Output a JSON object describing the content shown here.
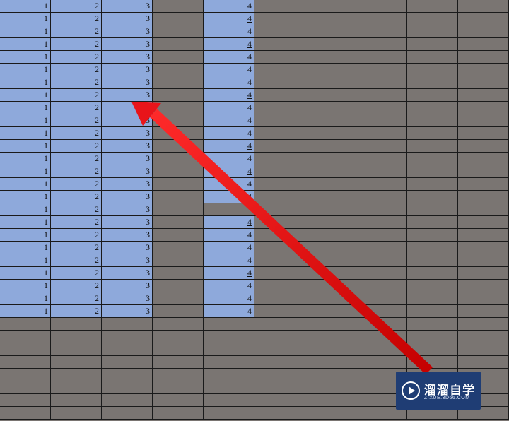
{
  "sheet": {
    "row_count": 25,
    "columns": [
      {
        "value": "1"
      },
      {
        "value": "2"
      },
      {
        "value": "3"
      },
      {
        "value": ""
      },
      {
        "value": "4"
      }
    ],
    "col4_underlined_rows": [
      1,
      3,
      5,
      7,
      9,
      11,
      13,
      15,
      17,
      19,
      21,
      23
    ],
    "col4_missing_rows": [
      16
    ],
    "colors": {
      "selection": "#8ea9db",
      "background": "#7a7572",
      "gridline": "#1a1a1a"
    }
  },
  "annotation": {
    "type": "red-arrow",
    "color": "#e8141a"
  },
  "watermark": {
    "title": "溜溜自学",
    "url": "ZIXUE.3D66.COM",
    "icon": "play-icon",
    "background": "#1f3d74"
  }
}
